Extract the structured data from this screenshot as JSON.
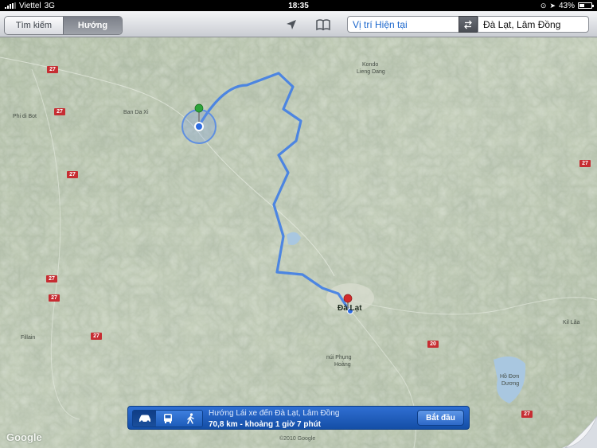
{
  "status_bar": {
    "carrier": "Viettel",
    "network": "3G",
    "time": "18:35",
    "battery_percent": 43,
    "battery_label": "43%"
  },
  "toolbar": {
    "search_tab": "Tìm kiếm",
    "directions_tab": "Hướng",
    "start_field": "Vị trí Hiện tại",
    "end_field": "Đà Lạt, Lâm Đồng",
    "accent_color": "#1a66cc"
  },
  "map": {
    "labels": {
      "phi_di_bot": "Phi di Bot",
      "ban_da_xi": "Ban Da Xi",
      "kondo": "Kondo",
      "lieng_dang": "Lieng Dang",
      "fillain": "Fillain",
      "nui_phung": "núi Phụng",
      "hoang": "Hoàng",
      "ho_don": "Hồ Đơn",
      "duong": "Dương",
      "kil_laa": "Kil Lãa",
      "da_lat": "Đà Lạt"
    },
    "road_shields": {
      "r27": "27",
      "r20": "20"
    }
  },
  "route_bar": {
    "line1": "Hướng Lái xe đến Đà Lạt, Lâm Đồng",
    "line2": "70,8 km - khoảng 1 giờ 7 phút",
    "start_button": "Bắt đầu",
    "selected_mode": "car"
  },
  "footer": {
    "google_logo": "Google",
    "copyright": "©2010 Google"
  },
  "icons": [
    "location-arrow-icon",
    "bookmarks-icon",
    "swap-icon",
    "car-icon",
    "bus-icon",
    "walk-icon",
    "start-pin-icon",
    "end-pin-icon"
  ]
}
